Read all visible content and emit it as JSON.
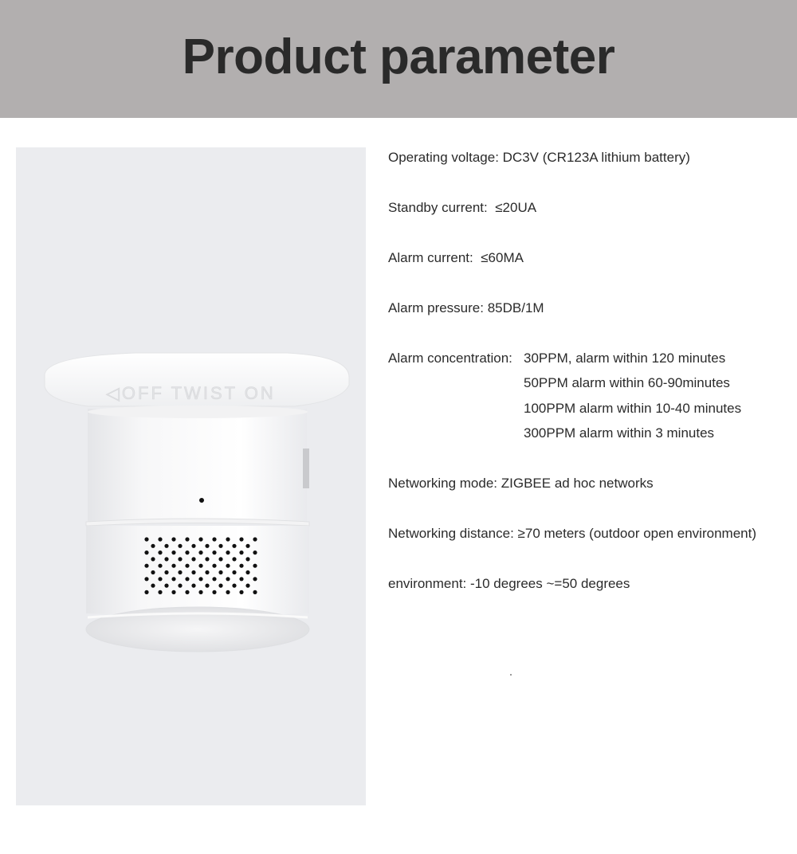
{
  "header": {
    "title": "Product parameter"
  },
  "product_image": {
    "alt": "Zigbee CO detector product photo",
    "embossed_text": "OFF TWIST ON"
  },
  "specs": [
    {
      "label": "Operating voltage:",
      "value": "DC3V (CR123A lithium battery)"
    },
    {
      "label": "Standby current:",
      "value": "≤20UA"
    },
    {
      "label": "Alarm current:",
      "value": "≤60MA"
    },
    {
      "label": "Alarm pressure:",
      "value": "85DB/1M"
    },
    {
      "label": "Alarm concentration:",
      "values": [
        "30PPM, alarm within 120 minutes",
        "50PPM alarm within 60-90minutes",
        "100PPM alarm within 10-40 minutes",
        "300PPM alarm within 3 minutes"
      ]
    },
    {
      "label": "Networking mode:",
      "value": "ZIGBEE ad hoc networks"
    },
    {
      "label": "Networking distance:",
      "value": "≥70 meters (outdoor open environment)"
    },
    {
      "label": "environment:",
      "value": "-10 degrees ~=50 degrees"
    }
  ]
}
